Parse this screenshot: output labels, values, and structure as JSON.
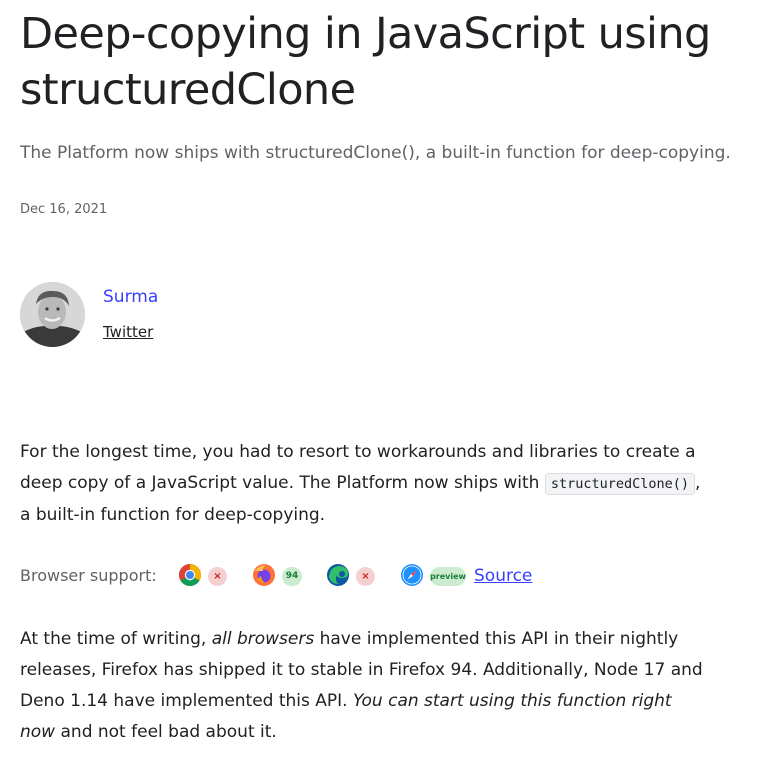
{
  "article": {
    "title": "Deep-copying in JavaScript using structuredClone",
    "subtitle": "The Platform now ships with structuredClone(), a built-in function for deep-copying.",
    "date": "Dec 16, 2021"
  },
  "author": {
    "name": "Surma",
    "link_label": "Twitter"
  },
  "intro": {
    "text_before_code": "For the longest time, you had to resort to workarounds and libraries to create a deep copy of a JavaScript value. The Platform now ships with ",
    "code": "structuredClone()",
    "text_after_code": ", a built-in function for deep-copying."
  },
  "browser_support": {
    "label": "Browser support:",
    "browsers": [
      {
        "name": "chrome-icon",
        "status": "×",
        "supported": false
      },
      {
        "name": "firefox-icon",
        "status": "94",
        "supported": true
      },
      {
        "name": "edge-icon",
        "status": "×",
        "supported": false
      },
      {
        "name": "safari-icon",
        "status": "preview",
        "supported": true
      }
    ],
    "source_label": "Source"
  },
  "status_paragraph": {
    "p1": "At the time of writing, ",
    "em1": "all browsers",
    "p2": " have implemented this API in their nightly releases, Firefox has shipped it to stable in Firefox 94. Additionally, Node 17 and Deno 1.14 have implemented this API. ",
    "em2": "You can start using this function right now",
    "p3": " and not feel bad about it."
  },
  "colors": {
    "link": "#3740ff",
    "text": "#202124",
    "muted": "#5f6368"
  }
}
